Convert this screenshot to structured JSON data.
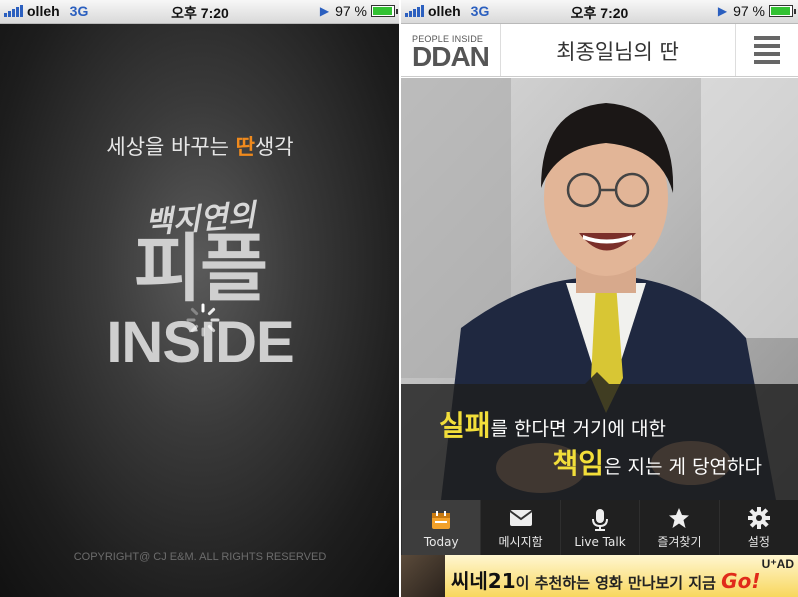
{
  "status_bar": {
    "carrier": "olleh",
    "network": "3G",
    "time": "오후 7:20",
    "battery_percent": "97 %",
    "battery_level": 0.97
  },
  "splash": {
    "tagline_prefix": "세상을 바꾸는 ",
    "tagline_highlight": "딴",
    "tagline_suffix": "생각",
    "logo_script": "백지연의",
    "logo_main": "피플",
    "logo_sub": "INSIDE",
    "copyright": "COPYRIGHT@ CJ E&M. ALL RIGHTS RESERVED"
  },
  "app": {
    "brand_small": "PEOPLE INSIDE",
    "brand_big": "DDAN",
    "title": "최종일님의 딴",
    "menu_icon": "list-menu-icon",
    "caption": {
      "line1_em": "실패",
      "line1_rest": "를 한다면 거기에 대한",
      "line2_em": "책임",
      "line2_rest": "은 지는 게 당연하다"
    },
    "tabs": [
      {
        "label": "Today",
        "icon": "calendar-icon"
      },
      {
        "label": "메시지함",
        "icon": "mail-icon"
      },
      {
        "label": "Live Talk",
        "icon": "microphone-icon"
      },
      {
        "label": "즐겨찾기",
        "icon": "star-icon"
      },
      {
        "label": "설정",
        "icon": "gear-icon"
      }
    ],
    "active_tab": "Today",
    "accent_color": "#f2a12a",
    "ad": {
      "brand": "씨네21",
      "text": "이 추천하는 영화 만나보기 지금 ",
      "go": "Go!",
      "badge": "U⁺AD"
    }
  }
}
